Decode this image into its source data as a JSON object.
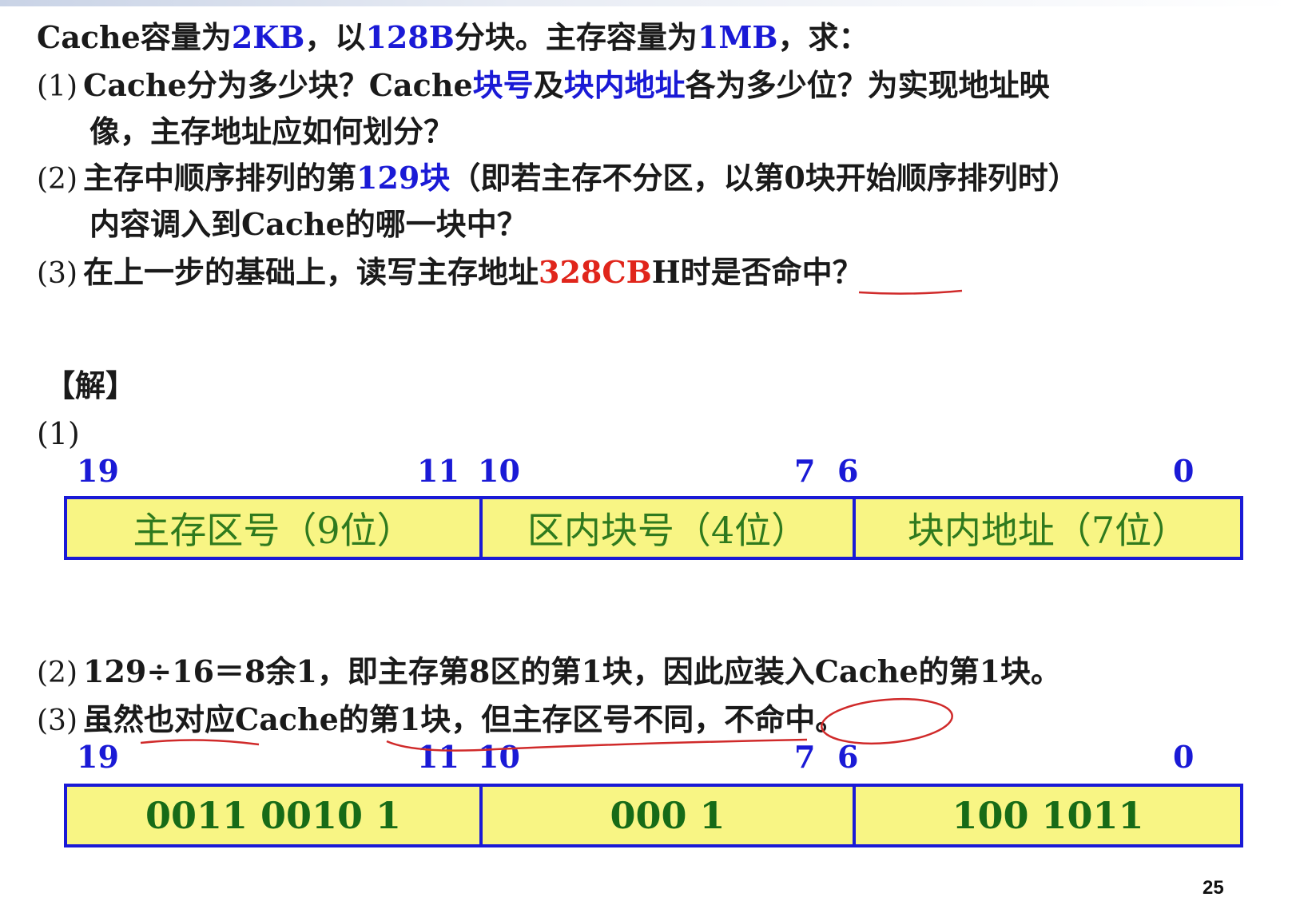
{
  "question": {
    "line1": {
      "a": "Cache容量为",
      "b": "2KB",
      "c": "，以",
      "d": "128B",
      "e": "分块。主存容量为",
      "f": "1MB",
      "g": "，求："
    },
    "q1": {
      "num": "(1)",
      "a": "Cache分为多少块？Cache",
      "b": "块号",
      "c": "及",
      "d": "块内地址",
      "e": "各为多少位？为实现地址映",
      "cont": "像，主存地址应如何划分？"
    },
    "q2": {
      "num": "(2)",
      "a": "主存中顺序排列的第",
      "b": "129块",
      "c": "（即若主存不分区，以第0块开始顺序排列时）",
      "cont": "内容调入到Cache的哪一块中？"
    },
    "q3": {
      "num": "(3)",
      "a": "在上一步的基础上，读写主存地址",
      "b": "328CB",
      "c": "H",
      "d": "时是否命中？"
    }
  },
  "solution": {
    "header": "【解】",
    "part1": "(1)",
    "bits": {
      "b19": "19",
      "b11": "11",
      "b10": "10",
      "b7": "7",
      "b6": "6",
      "b0": "0"
    },
    "fields": [
      "主存区号（9位）",
      "区内块号（4位）",
      "块内地址（7位）"
    ],
    "a2": {
      "num": "(2)",
      "text": "129÷16＝8余1，即主存第8区的第1块，因此应装入Cache的第1块。"
    },
    "a3": {
      "num": "(3)",
      "text": "虽然也对应Cache的第1块，但主存区号不同，不命中。"
    },
    "values": [
      "0011 0010 1",
      "000 1",
      "100 1011"
    ]
  },
  "page_number": "25",
  "colors": {
    "highlight": "#1a1ad6",
    "address": "#e0251b",
    "field_bg": "#f8f584",
    "annotation": "#d02a2a"
  }
}
